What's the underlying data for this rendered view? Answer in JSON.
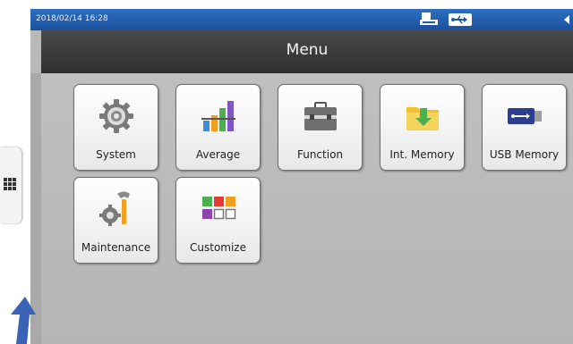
{
  "status_bar": {
    "datetime": "2018/02/14 16:28",
    "icons": [
      "printer-icon",
      "usb-icon",
      "navigation-arrows-icon"
    ]
  },
  "header": {
    "title": "Menu"
  },
  "side_tab": {
    "icon": "grid-icon"
  },
  "menu": {
    "items": [
      {
        "label": "System",
        "icon": "gear-icon"
      },
      {
        "label": "Average",
        "icon": "bar-chart-icon"
      },
      {
        "label": "Function",
        "icon": "toolbox-icon"
      },
      {
        "label": "Int. Memory",
        "icon": "folder-download-icon"
      },
      {
        "label": "USB Memory",
        "icon": "usb-drive-icon"
      },
      {
        "label": "Maintenance",
        "icon": "wrench-gear-icon"
      },
      {
        "label": "Customize",
        "icon": "color-grid-icon"
      }
    ]
  },
  "colors": {
    "status_bar": "#1f5aa8",
    "title_bar": "#3a3a3a",
    "background": "#b9b9b9",
    "pointer_arrow": "#3a63b5"
  }
}
